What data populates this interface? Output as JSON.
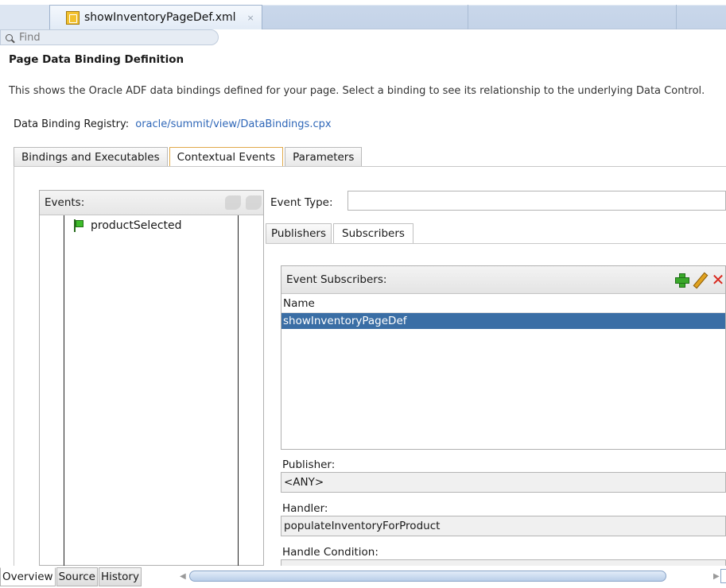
{
  "editor": {
    "tab_label": "showInventoryPageDef.xml",
    "tab_close": "×"
  },
  "find": {
    "placeholder": "Find"
  },
  "page": {
    "title": "Page Data Binding Definition",
    "description": "This shows the Oracle ADF data bindings defined for your page. Select a binding to see its relationship to the underlying Data Control.",
    "registry_label": "Data Binding Registry:",
    "registry_link": "oracle/summit/view/DataBindings.cpx"
  },
  "main_tabs": [
    {
      "label": "Bindings and Executables",
      "active": false
    },
    {
      "label": "Contextual Events",
      "active": true
    },
    {
      "label": "Parameters",
      "active": false
    }
  ],
  "events": {
    "header": "Events:",
    "items": [
      {
        "label": "productSelected",
        "icon": "green-flag-icon"
      }
    ]
  },
  "event_type": {
    "label": "Event Type:",
    "value": ""
  },
  "sub_tabs": [
    {
      "label": "Publishers",
      "active": false
    },
    {
      "label": "Subscribers",
      "active": true
    }
  ],
  "subscribers": {
    "header": "Event Subscribers:",
    "column": "Name",
    "rows": [
      "showInventoryPageDef"
    ],
    "selected_color": "#3a6ea5"
  },
  "publisher": {
    "label": "Publisher:",
    "value": "<ANY>"
  },
  "handler": {
    "label": "Handler:",
    "value": "populateInventoryForProduct"
  },
  "handle_condition": {
    "label": "Handle Condition:",
    "value": ""
  },
  "bottom_tabs": [
    {
      "label": "Overview",
      "active": true
    },
    {
      "label": "Source",
      "active": false
    },
    {
      "label": "History",
      "active": false
    }
  ]
}
